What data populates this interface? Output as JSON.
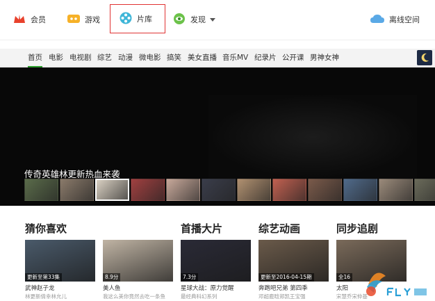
{
  "topnav": {
    "vip_label": "会员",
    "game_label": "游戏",
    "library_label": "片库",
    "discover_label": "发现",
    "cloud_label": "离线空间"
  },
  "categories": [
    "首页",
    "电影",
    "电视剧",
    "综艺",
    "动漫",
    "微电影",
    "搞笑",
    "美女直播",
    "音乐MV",
    "纪录片",
    "公开课",
    "男神女神"
  ],
  "banner": {
    "title": "传奇英雄林更新热血来袭",
    "thumb_colors": [
      "#5a6b4a",
      "#8a7a6a",
      "#d9d0c2",
      "#a04040",
      "#c7a89a",
      "#3a3d4a",
      "#b09070",
      "#c06050",
      "#7a5a4a",
      "#506a8a",
      "#9a8a7a",
      "#6a6a5a"
    ]
  },
  "sections": {
    "guess": "猜你喜欢",
    "premiere": "首播大片",
    "variety": "综艺动画",
    "drama": "同步追剧"
  },
  "cards": [
    {
      "title": "武神赵子龙",
      "sub": "林更新倩幸林允儿",
      "badge": "更新至第33集",
      "color": "#4a5a6a"
    },
    {
      "title": "美人鱼",
      "sub": "我这么美你竟然去吃一条鱼",
      "badge": "8.9分",
      "color": "#c0b4a4"
    },
    {
      "title": "星球大战：原力觉醒",
      "sub": "最经典科幻系列",
      "badge": "7.3分",
      "color": "#2a2a36"
    },
    {
      "title": "奔跑吧兄弟 第四季",
      "sub": "邓超鹿晗郑凯王宝强",
      "badge": "更新至2016-04-15期",
      "color": "#6a5a4a"
    },
    {
      "title": "太阳",
      "sub": "宋慧乔宋仲基",
      "badge": "全16",
      "color": "#7a6a5a"
    }
  ]
}
